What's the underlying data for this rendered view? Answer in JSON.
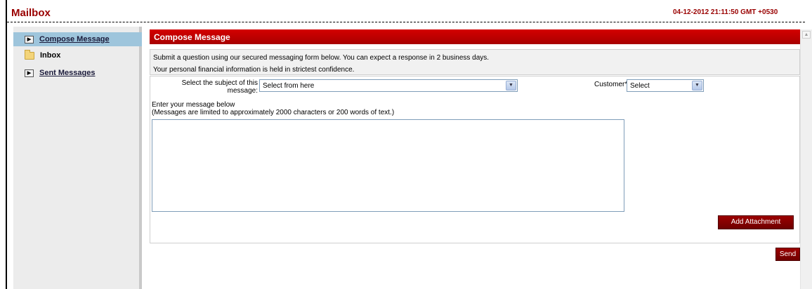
{
  "app": {
    "title": "Mailbox",
    "timestamp": "04-12-2012 21:11:50 GMT +0530"
  },
  "sidebar": {
    "items": [
      {
        "label": "Compose Message",
        "icon": "triangle-right-icon",
        "active": true,
        "link": true
      },
      {
        "label": "Inbox",
        "icon": "folder-icon",
        "active": false,
        "link": false
      },
      {
        "label": "Sent Messages",
        "icon": "triangle-right-icon",
        "active": false,
        "link": true
      }
    ]
  },
  "main": {
    "header": "Compose Message",
    "info_line1": "Submit a question using our secured messaging form below. You can expect a response in 2 business days.",
    "info_line2": "Your personal financial information is held in strictest confidence.",
    "subject_label_line1": "Select the subject of this",
    "subject_label_line2": "message:",
    "subject_select_value": "Select from here",
    "customer_label": "Customer*:",
    "customer_select_value": "Select",
    "message_hint_line1": "Enter your message below",
    "message_hint_line2": "(Messages are limited to approximately 2000 characters or 200 words of text.)",
    "message_value": "",
    "add_attachment_label": "Add Attachment",
    "send_label": "Send"
  },
  "colors": {
    "brand": "#990000",
    "header_bar": "#c00000",
    "sidebar_active": "#9ec5dc",
    "sidebar_bg": "#ececec"
  }
}
